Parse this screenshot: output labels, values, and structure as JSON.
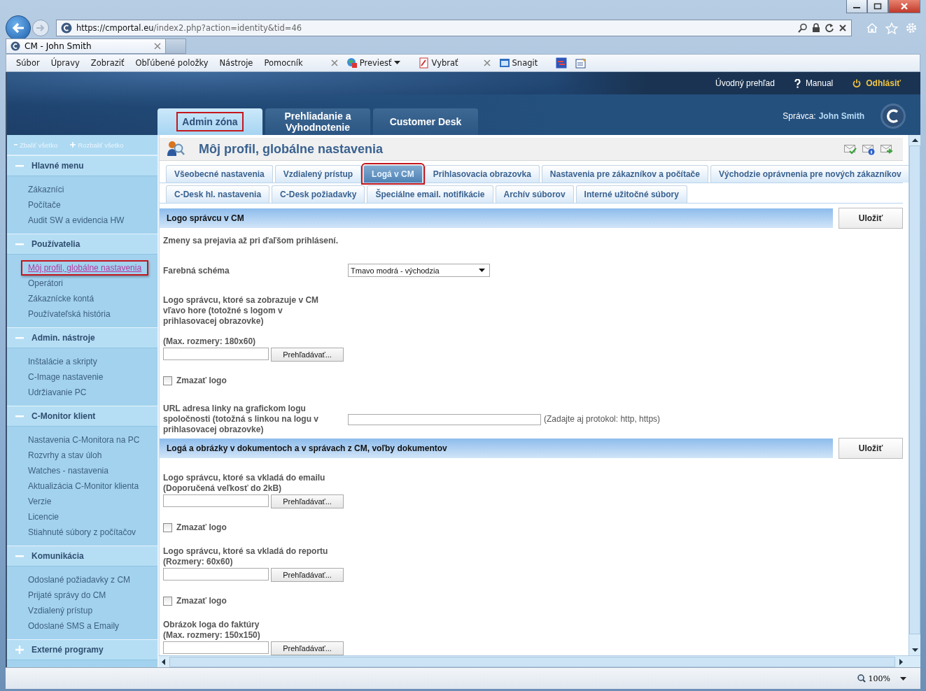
{
  "browser": {
    "url_host": "https://cmportal.eu",
    "url_path": "/index2.php?action=identity&tid=46",
    "tab_title": "CM - John Smith",
    "menu": [
      "Súbor",
      "Úpravy",
      "Zobraziť",
      "Obľúbené položky",
      "Nástroje",
      "Pomocník"
    ],
    "toolbar": [
      {
        "label": "Previesť",
        "dropdown": true
      },
      {
        "label": "Vybrať",
        "dropdown": false
      },
      {
        "label": "Snagit",
        "dropdown": false
      }
    ],
    "zoom": "100%"
  },
  "header": {
    "links": [
      {
        "kind": "plain",
        "label": "Úvodný prehľad"
      },
      {
        "kind": "help",
        "label": "Manual"
      },
      {
        "kind": "logout",
        "label": "Odhlásiť"
      }
    ],
    "tabs": [
      {
        "label": "Admin zóna",
        "selected": true,
        "highlighted": true
      },
      {
        "label": "Prehliadanie a Vyhodnotenie",
        "selected": false,
        "highlighted": false
      },
      {
        "label": "Customer Desk",
        "selected": false,
        "highlighted": false
      }
    ],
    "admin_label": "Správca:",
    "admin_name": "John Smith"
  },
  "sidebar": {
    "collapse_all": "Zbaliť všetko",
    "expand_all": "Rozbaliť všetko",
    "sections": [
      {
        "title": "Hlavné menu",
        "expanded": true,
        "items": [
          {
            "label": "Zákazníci",
            "selected": false,
            "highlighted": false
          },
          {
            "label": "Počítače",
            "selected": false,
            "highlighted": false
          },
          {
            "label": "Audit SW a evidencia HW",
            "selected": false,
            "highlighted": false
          }
        ]
      },
      {
        "title": "Používatelia",
        "expanded": true,
        "items": [
          {
            "label": "Môj profil, globálne nastavenia",
            "selected": true,
            "highlighted": true
          },
          {
            "label": "Operátori",
            "selected": false,
            "highlighted": false
          },
          {
            "label": "Zákaznícke kontá",
            "selected": false,
            "highlighted": false
          },
          {
            "label": "Používateľská história",
            "selected": false,
            "highlighted": false
          }
        ]
      },
      {
        "title": "Admin. nástroje",
        "expanded": true,
        "items": [
          {
            "label": "Inštalácie a skripty",
            "selected": false,
            "highlighted": false
          },
          {
            "label": "C-Image nastavenie",
            "selected": false,
            "highlighted": false
          },
          {
            "label": "Udržiavanie PC",
            "selected": false,
            "highlighted": false
          }
        ]
      },
      {
        "title": "C-Monitor klient",
        "expanded": true,
        "items": [
          {
            "label": "Nastavenia C-Monitora na PC",
            "selected": false,
            "highlighted": false
          },
          {
            "label": "Rozvrhy a stav úloh",
            "selected": false,
            "highlighted": false
          },
          {
            "label": "Watches - nastavenia",
            "selected": false,
            "highlighted": false
          },
          {
            "label": "Aktualizácia C-Monitor klienta",
            "selected": false,
            "highlighted": false
          },
          {
            "label": "Verzie",
            "selected": false,
            "highlighted": false
          },
          {
            "label": "Licencie",
            "selected": false,
            "highlighted": false
          },
          {
            "label": "Stiahnuté súbory z počítačov",
            "selected": false,
            "highlighted": false
          }
        ]
      },
      {
        "title": "Komunikácia",
        "expanded": true,
        "items": [
          {
            "label": "Odoslané požiadavky z CM",
            "selected": false,
            "highlighted": false
          },
          {
            "label": "Prijaté správy do CM",
            "selected": false,
            "highlighted": false
          },
          {
            "label": "Vzdialený prístup",
            "selected": false,
            "highlighted": false
          },
          {
            "label": "Odoslané SMS a Emaily",
            "selected": false,
            "highlighted": false
          }
        ]
      },
      {
        "title": "Externé programy",
        "expanded": false
      }
    ]
  },
  "content": {
    "title": "Môj profil, globálne nastavenia",
    "tab_rows": [
      [
        {
          "label": "Všeobecné nastavenia",
          "selected": false,
          "highlighted": false
        },
        {
          "label": "Vzdialený prístup",
          "selected": false,
          "highlighted": false
        },
        {
          "label": "Logá v CM",
          "selected": true,
          "highlighted": true
        },
        {
          "label": "Prihlasovacia obrazovka",
          "selected": false,
          "highlighted": false
        },
        {
          "label": "Nastavenia pre zákazníkov a počítače",
          "selected": false,
          "highlighted": false
        },
        {
          "label": "Východzie oprávnenia pre nových zákazníkov",
          "selected": false,
          "highlighted": false
        }
      ],
      [
        {
          "label": "C-Desk hl. nastavenia",
          "selected": false,
          "highlighted": false
        },
        {
          "label": "C-Desk požiadavky",
          "selected": false,
          "highlighted": false
        },
        {
          "label": "Špeciálne email. notifikácie",
          "selected": false,
          "highlighted": false
        },
        {
          "label": "Archív súborov",
          "selected": false,
          "highlighted": false
        },
        {
          "label": "Interné užitočné súbory",
          "selected": false,
          "highlighted": false
        }
      ]
    ],
    "sections": [
      {
        "title": "Logo správcu v CM",
        "save_label": "Uložiť",
        "rows": [
          {
            "kind": "note",
            "label": "Zmeny sa prejavia až pri ďaľšom prihlásení."
          },
          {
            "kind": "select",
            "label": "Farebná schéma",
            "value": "Tmavo modrá - východzia"
          },
          {
            "kind": "text",
            "label": "Logo správcu, ktoré sa zobrazuje v CM vľavo hore (totožné s logom v prihlasovacej obrazovke)"
          },
          {
            "kind": "file",
            "label": "(Max. rozmery: 180x60)",
            "button": "Prehľadávať..."
          },
          {
            "kind": "checkbox",
            "label": "Zmazať logo",
            "checked": false
          },
          {
            "kind": "url",
            "label": "URL adresa linky na grafickom logu spoločnosti (totožná s linkou na logu v prihlasovacej obrazovke)",
            "hint": "(Zadajte aj protokol: http, https)"
          }
        ]
      },
      {
        "title": "Logá a obrázky v dokumentoch a v správach z CM, voľby dokumentov",
        "save_label": "Uložiť",
        "rows": [
          {
            "kind": "file",
            "label": "Logo správcu, ktoré sa vkladá do emailu",
            "sublabel": "(Doporučená veľkosť do 2kB)",
            "button": "Prehľadávať..."
          },
          {
            "kind": "checkbox",
            "label": "Zmazať logo",
            "checked": false
          },
          {
            "kind": "file",
            "label": "Logo správcu, ktoré sa vkladá do reportu",
            "sublabel": "(Rozmery: 60x60)",
            "button": "Prehľadávať..."
          },
          {
            "kind": "checkbox",
            "label": "Zmazať logo",
            "checked": false
          },
          {
            "kind": "file",
            "label": "Obrázok loga do faktúry",
            "sublabel": "(Max. rozmery: 150x150)",
            "button": "Prehľadávať..."
          }
        ]
      }
    ]
  }
}
